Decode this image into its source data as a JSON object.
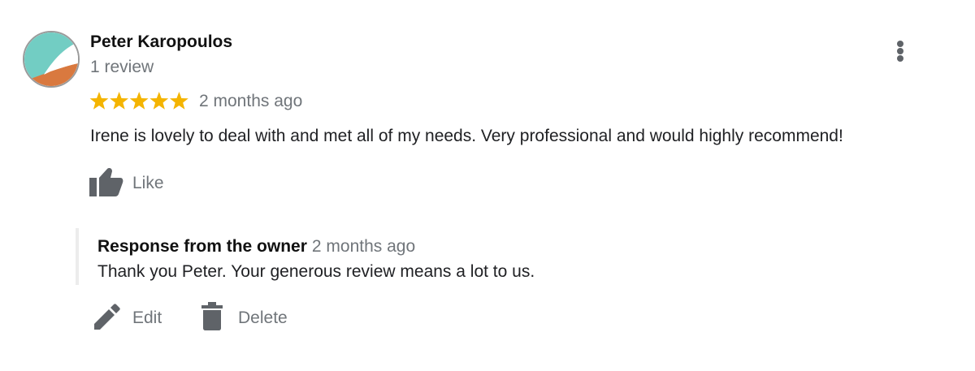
{
  "review": {
    "reviewer_name": "Peter Karopoulos",
    "review_count": "1 review",
    "rating": 5,
    "rating_max": 5,
    "date": "2 months ago",
    "text": "Irene is lovely to deal with and met all of my needs. Very professional and would highly recommend!",
    "like_label": "Like"
  },
  "owner_response": {
    "title": "Response from the owner",
    "date": "2 months ago",
    "text": "Thank you Peter. Your generous review means a lot to us."
  },
  "actions": {
    "edit_label": "Edit",
    "delete_label": "Delete"
  },
  "icons": {
    "avatar": "profile-avatar",
    "more": "more-vert-icon",
    "star": "star-icon",
    "like": "thumb-up-icon",
    "edit": "pencil-icon",
    "delete": "trash-icon"
  },
  "colors": {
    "star": "#f4b400",
    "secondary_text": "#70757a",
    "icon_gray": "#5f6368",
    "avatar_teal": "#72cdc3",
    "avatar_orange": "#d9793f"
  }
}
